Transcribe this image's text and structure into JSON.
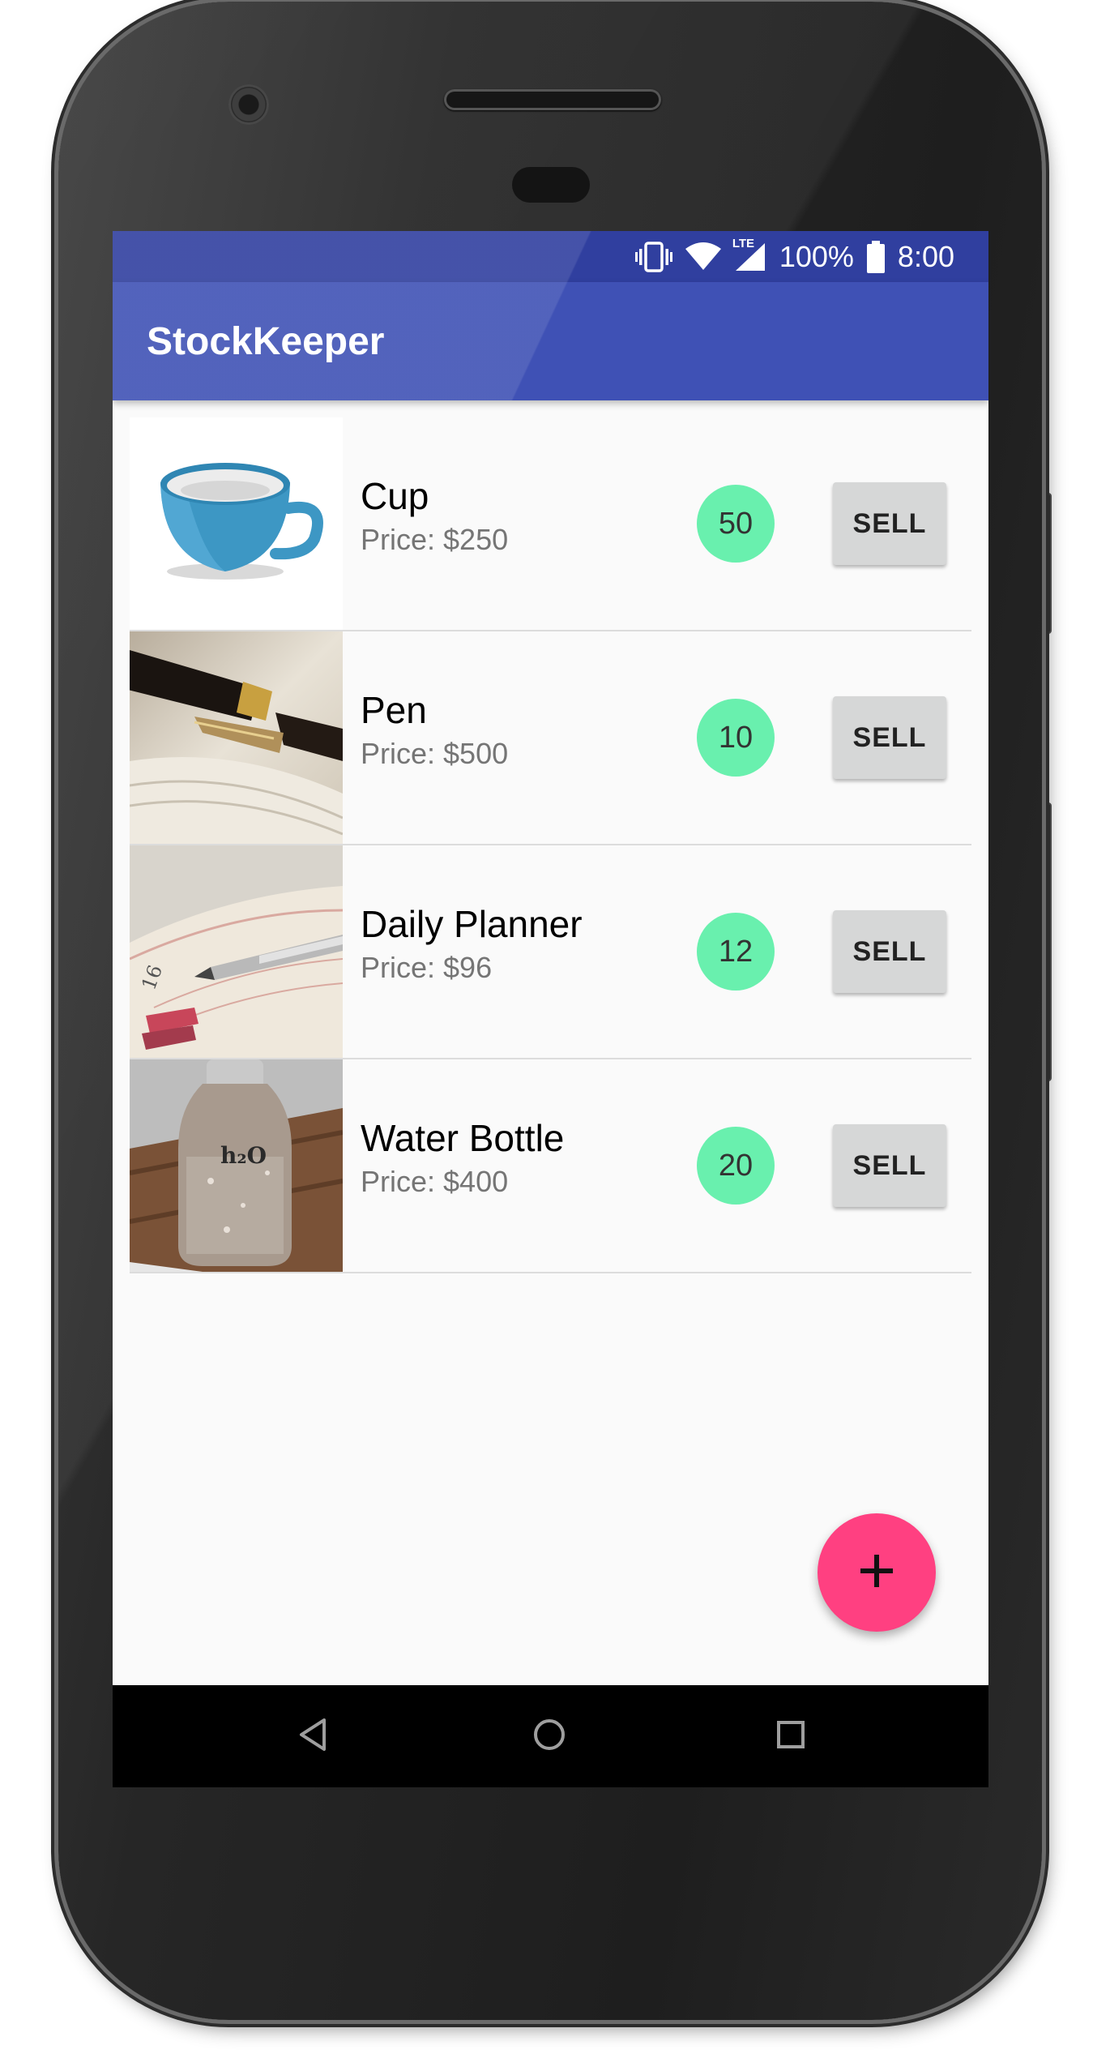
{
  "status_bar": {
    "battery": "100%",
    "time": "8:00",
    "network": "LTE",
    "icons": [
      "vibrate-icon",
      "wifi-icon",
      "cell-signal-icon",
      "battery-icon"
    ]
  },
  "app_bar": {
    "title": "StockKeeper"
  },
  "products": [
    {
      "name": "Cup",
      "price": "Price: $250",
      "quantity": "50",
      "sell_label": "SELL",
      "image": "cup-photo"
    },
    {
      "name": "Pen",
      "price": "Price: $500",
      "quantity": "10",
      "sell_label": "SELL",
      "image": "fountain-pen-photo"
    },
    {
      "name": "Daily Planner",
      "price": "Price: $96",
      "quantity": "12",
      "sell_label": "SELL",
      "image": "planner-photo"
    },
    {
      "name": "Water Bottle",
      "price": "Price: $400",
      "quantity": "20",
      "sell_label": "SELL",
      "image": "water-bottle-photo"
    }
  ],
  "fab": {
    "icon": "plus-icon"
  },
  "nav_bar": {
    "icons": [
      "back-icon",
      "home-icon",
      "recents-icon"
    ]
  },
  "colors": {
    "primary": "#3f51b5",
    "primary_dark": "#303f9f",
    "accent": "#ff4081",
    "quantity_badge": "#69f0ae"
  }
}
